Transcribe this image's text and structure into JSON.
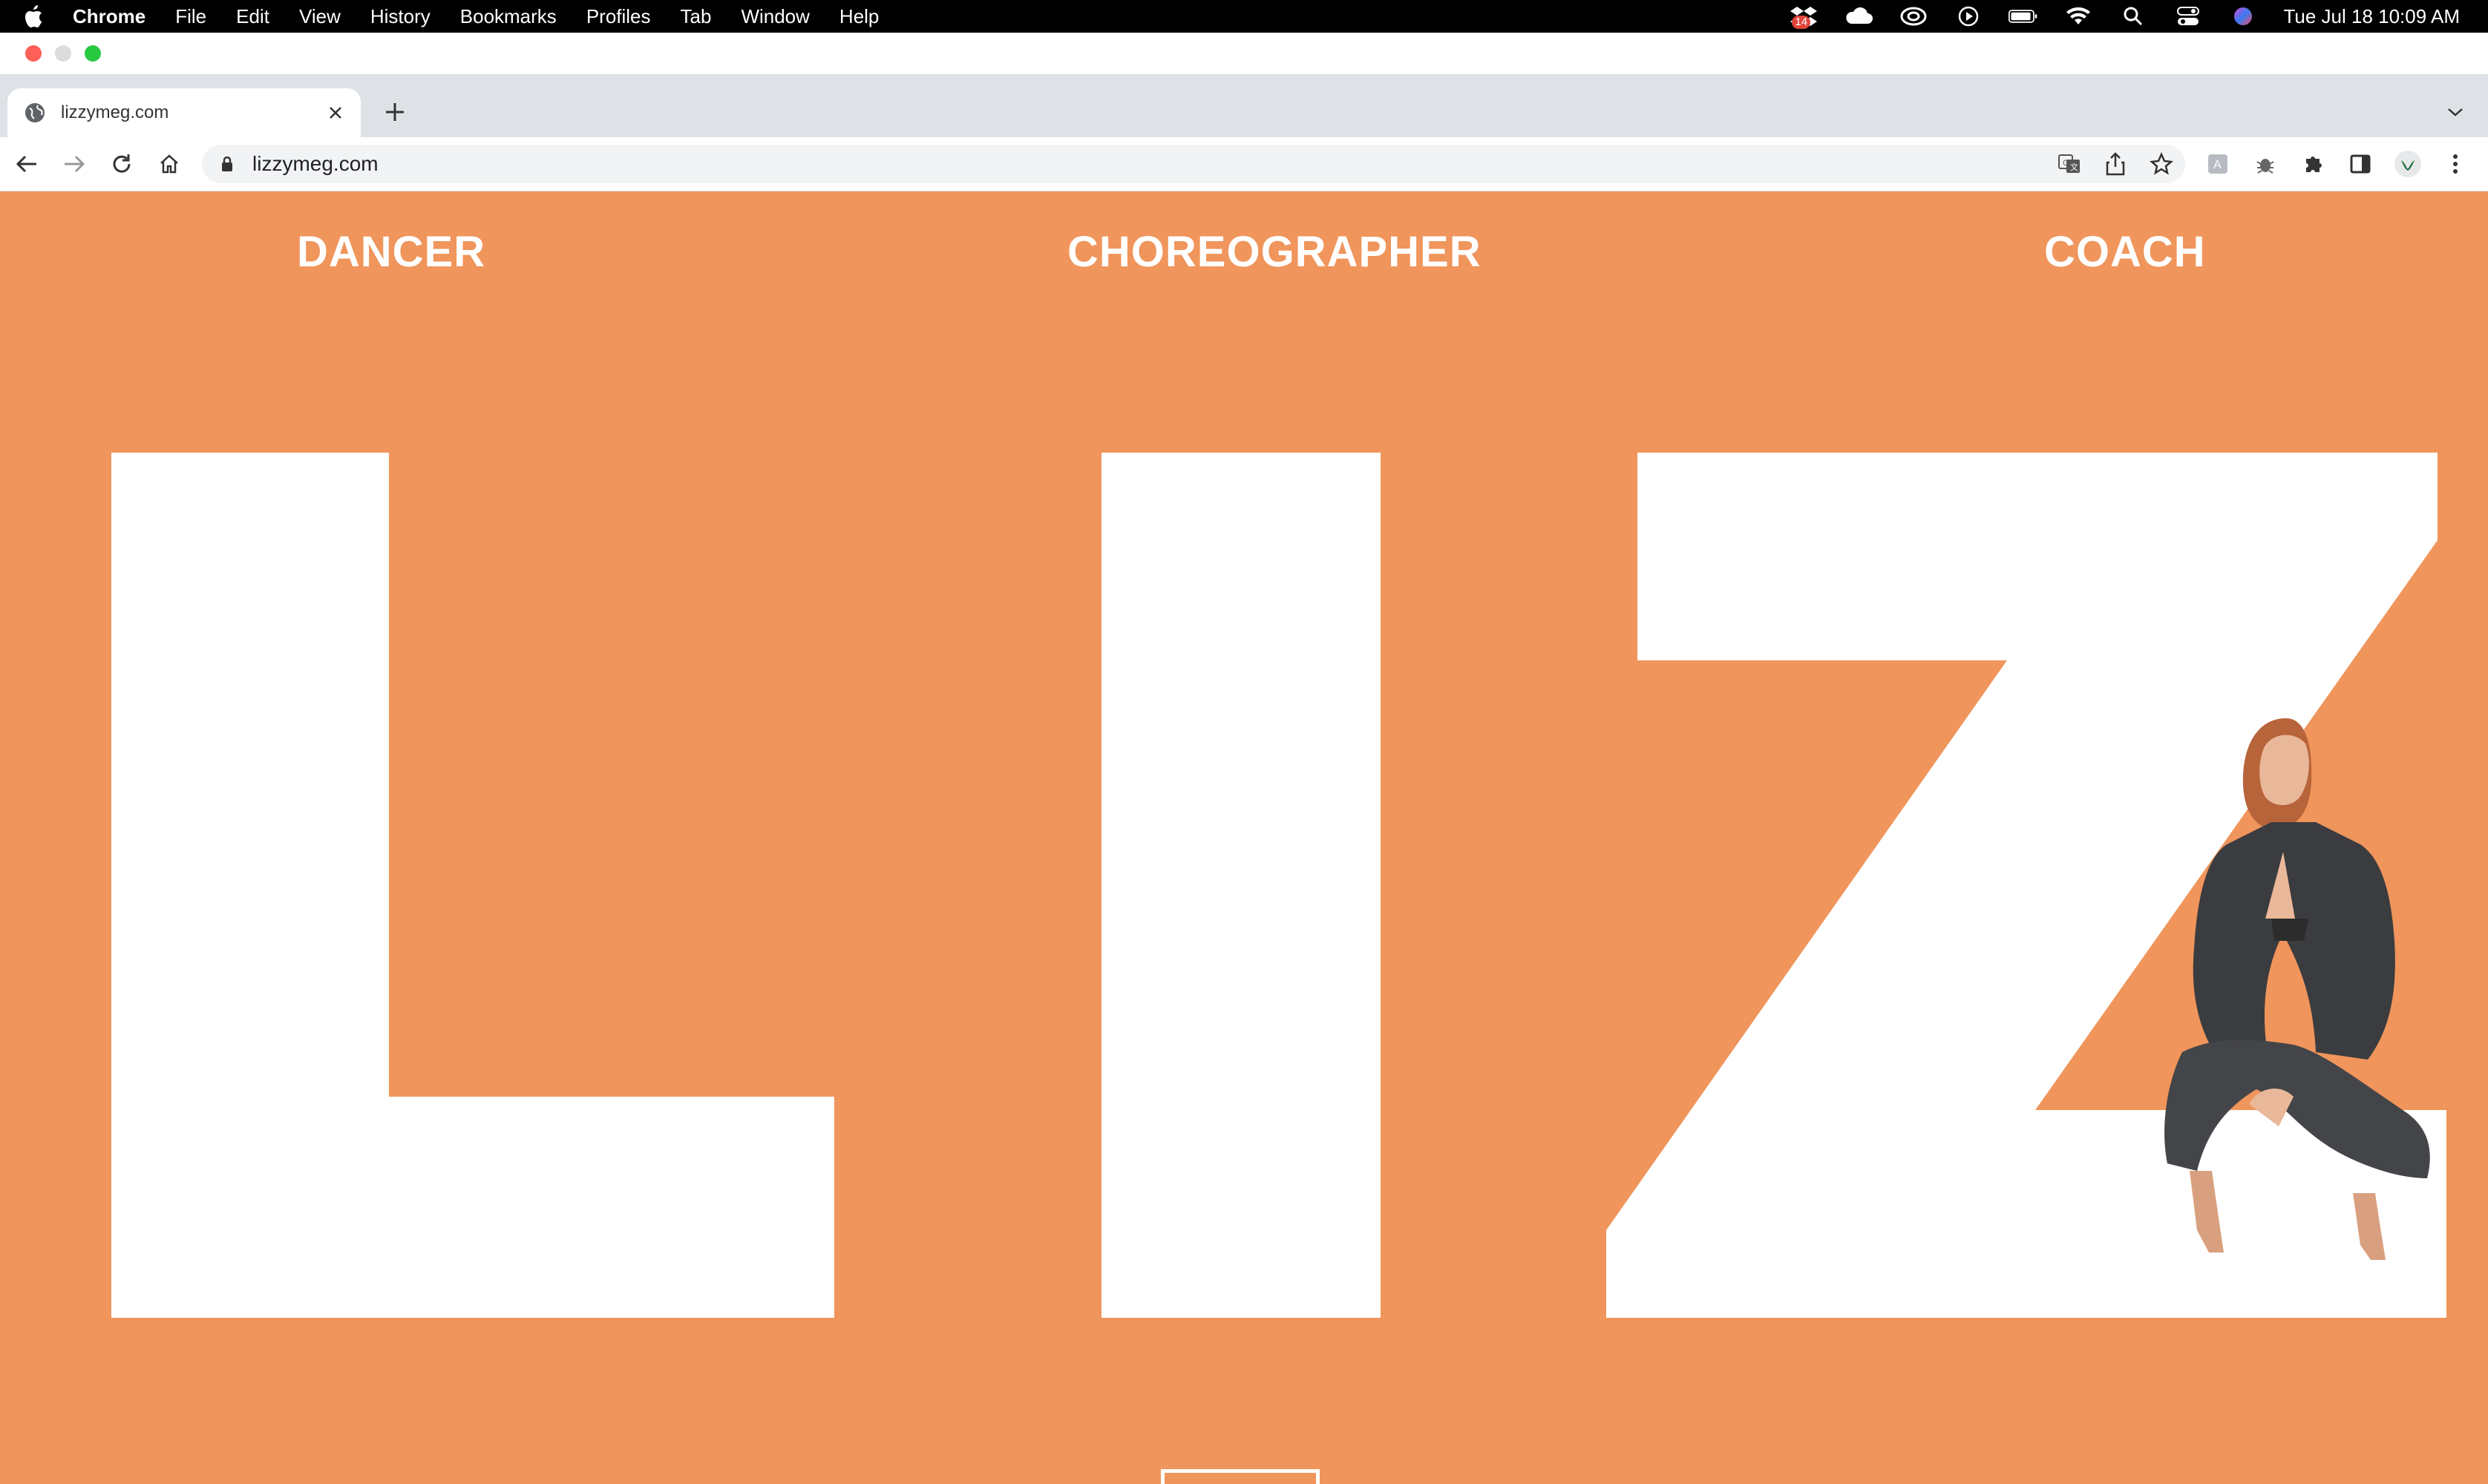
{
  "menubar": {
    "app": "Chrome",
    "items": [
      "File",
      "Edit",
      "View",
      "History",
      "Bookmarks",
      "Profiles",
      "Tab",
      "Window",
      "Help"
    ],
    "status_icons": [
      "dropbox-icon",
      "cloud-icon",
      "creative-cloud-icon",
      "play-icon",
      "battery-icon",
      "wifi-icon",
      "spotlight-icon",
      "control-center-icon",
      "siri-icon"
    ],
    "badge": "14",
    "clock": "Tue Jul 18  10:09 AM"
  },
  "browser": {
    "tab_title": "lizzymeg.com",
    "url": "lizzymeg.com"
  },
  "site": {
    "nav": {
      "dancer": "DANCER",
      "choreographer": "CHOREOGRAPHER",
      "coach": "COACH"
    },
    "hero_letters": "LIZ",
    "colors": {
      "background": "#f0955b",
      "letters": "#ffffff"
    }
  }
}
